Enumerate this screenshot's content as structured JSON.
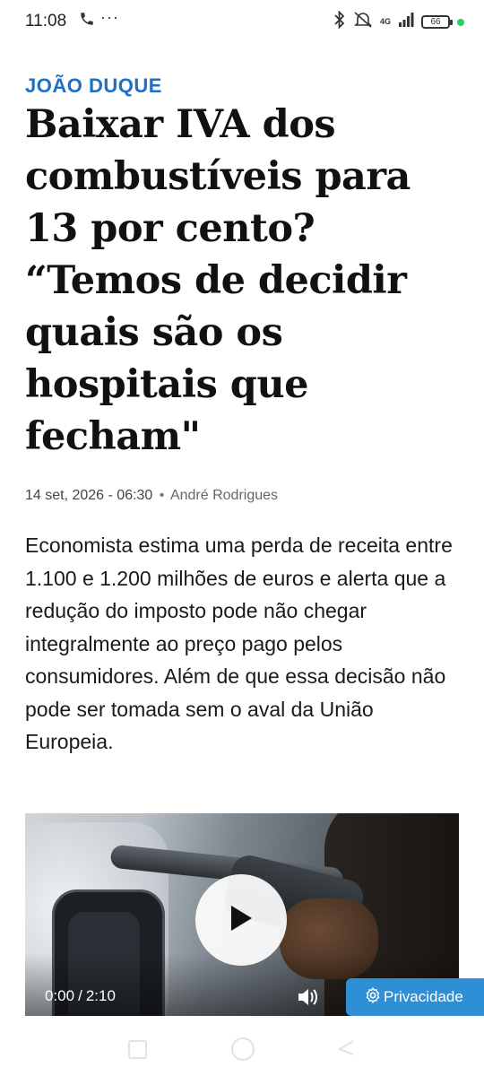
{
  "status_bar": {
    "time": "11:08",
    "more": "···",
    "network": "4G",
    "battery": "66",
    "icons": [
      "phone-icon",
      "bluetooth-icon",
      "mute-icon",
      "signal-icon",
      "battery-icon"
    ],
    "dot_color": "#2ecc5a"
  },
  "article": {
    "kicker": "JOÃO DUQUE",
    "headline": "Baixar IVA dos combustíveis para 13 por cento? “Temos de decidir quais são os hospitais que fecham\"",
    "date": "14 set, 2026 - 06:30",
    "separator": "•",
    "author": "André Rodrigues",
    "lede": "Economista estima uma perda de receita entre 1.100 e 1.200 milhões de euros e alerta que a redução do imposto pode não chegar integralmente ao preço pago pelos consumidores. Além de que essa decisão não pode ser tomada sem o aval da União Europeia."
  },
  "video": {
    "current_time": "0:00",
    "slash": "/",
    "duration": "2:10"
  },
  "privacy": {
    "label": "Privacidade"
  },
  "colors": {
    "accent": "#1f6fc5",
    "privacy_bg": "#2f8fd6"
  }
}
